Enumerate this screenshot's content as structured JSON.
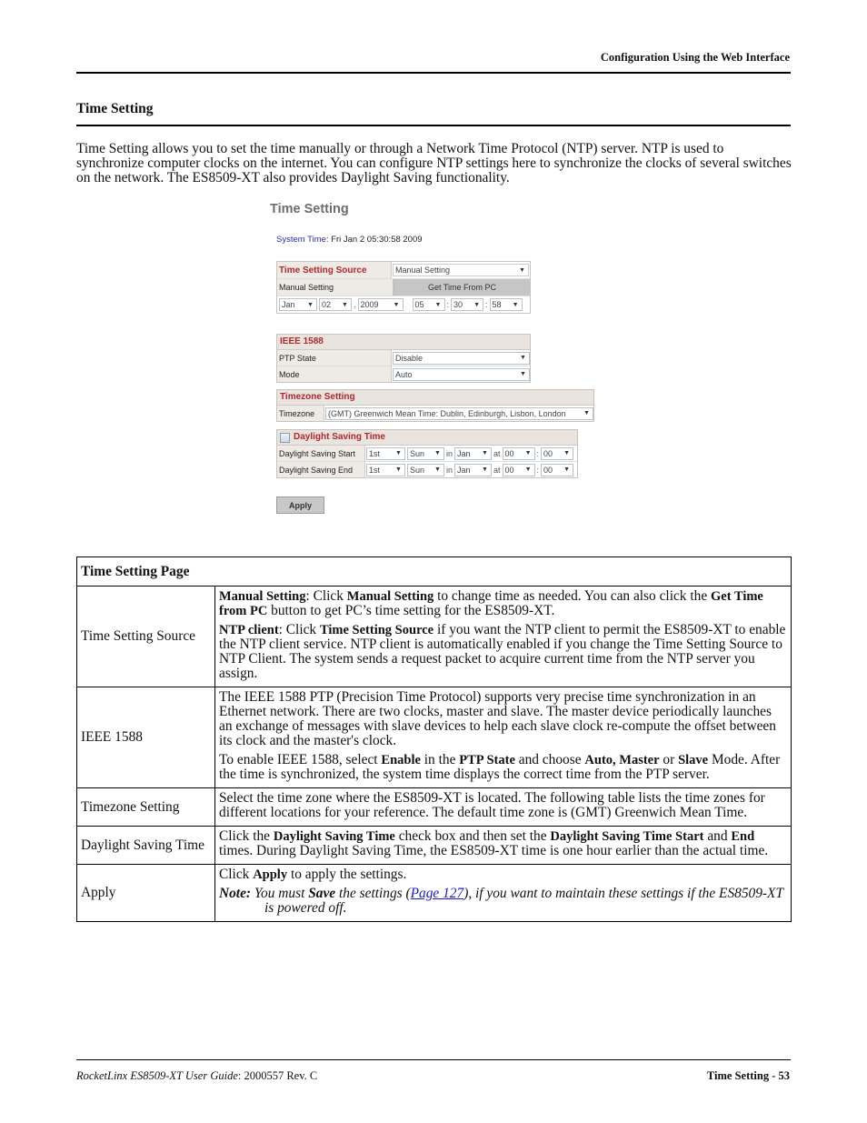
{
  "header": {
    "running_title": "Configuration Using the Web Interface"
  },
  "section": {
    "title": "Time Setting",
    "intro": "Time Setting allows you to set the time manually or through a Network Time Protocol (NTP) server. NTP is used to synchronize computer clocks on the internet. You can configure NTP settings here to synchronize the clocks of several switches on the network. The ES8509-XT also provides Daylight Saving functionality."
  },
  "ui": {
    "title": "Time Setting",
    "system_time_label": "System Time",
    "system_time_value": ": Fri Jan 2 05:30:58 2009",
    "time_source": {
      "header": "Time Setting Source",
      "value": "Manual Setting",
      "manual_label": "Manual Setting",
      "get_time_button": "Get Time From PC",
      "month": "Jan",
      "day": "02",
      "comma": ",",
      "year": "2009",
      "hour": "05",
      "colon": ":",
      "minute": "30",
      "second": "58"
    },
    "ieee": {
      "header": "IEEE 1588",
      "ptp_state_label": "PTP State",
      "ptp_state_value": "Disable",
      "mode_label": "Mode",
      "mode_value": "Auto"
    },
    "timezone": {
      "header": "Timezone Setting",
      "label": "Timezone",
      "value": "(GMT) Greenwich Mean Time: Dublin, Edinburgh, Lisbon, London"
    },
    "dst": {
      "header": "Daylight Saving Time",
      "checked": false,
      "in": "in",
      "at": "at",
      "colon": ":",
      "start": {
        "label": "Daylight Saving Start",
        "week": "1st",
        "day": "Sun",
        "month": "Jan",
        "hour": "00",
        "minute": "00"
      },
      "end": {
        "label": "Daylight Saving End",
        "week": "1st",
        "day": "Sun",
        "month": "Jan",
        "hour": "00",
        "minute": "00"
      }
    },
    "apply_button": "Apply"
  },
  "table": {
    "title": "Time Setting Page",
    "rows": [
      {
        "label": "Time Setting Source",
        "paras": [
          [
            "b:Manual Setting",
            ": Click ",
            "b:Manual Setting",
            " to change time as needed. You can also click the ",
            "b:Get Time from PC",
            " button to get PC’s time setting for the ES8509-XT."
          ],
          [
            "b:NTP client",
            ": Click ",
            "b:Time Setting Source",
            " if you want the NTP client to permit the ES8509-XT to enable the NTP client service. NTP client is automatically enabled if you change the Time Setting Source to NTP Client. The system sends a request packet to acquire current time from the NTP server you assign."
          ]
        ]
      },
      {
        "label": "IEEE 1588",
        "paras": [
          [
            "The IEEE 1588 PTP (Precision Time Protocol) supports very precise time synchronization in an Ethernet network. There are two clocks, master and slave. The master device periodically launches an exchange of messages with slave devices to help each slave clock re-compute the offset between its clock and the master's clock."
          ],
          [
            "To enable IEEE 1588, select ",
            "b:Enable",
            " in the ",
            "b:PTP State",
            " and choose ",
            "b:Auto, Master",
            " or ",
            "b:Slave",
            " Mode. After the time is synchronized, the system time displays the correct time from the PTP server."
          ]
        ]
      },
      {
        "label": "Timezone Setting",
        "paras": [
          [
            "Select the time zone where the ES8509-XT is located. The following table lists the time zones for different locations for your reference. The default time zone is (GMT) Greenwich Mean Time."
          ]
        ]
      },
      {
        "label": "Daylight Saving Time",
        "paras": [
          [
            "Click the ",
            "b:Daylight Saving Time",
            " check box and then set the ",
            "b:Daylight Saving Time Start",
            " and ",
            "b:End",
            " times. During Daylight Saving Time, the ES8509-XT time is one hour earlier than the actual time."
          ]
        ]
      },
      {
        "label": "Apply",
        "paras": [
          [
            "Click ",
            "b:Apply",
            " to apply the settings."
          ]
        ],
        "note": {
          "prefix": "Note:",
          "text1": " You must ",
          "bold": "Save",
          "text2": " the settings (",
          "link": "Page 127",
          "text3": "), if you want to maintain these settings if the ES8509-XT is powered off."
        }
      }
    ]
  },
  "footer": {
    "guide_title": "RocketLinx ES8509-XT User Guide",
    "doc_number": ": 2000557 Rev. C",
    "page_label": "Time Setting - 53"
  }
}
